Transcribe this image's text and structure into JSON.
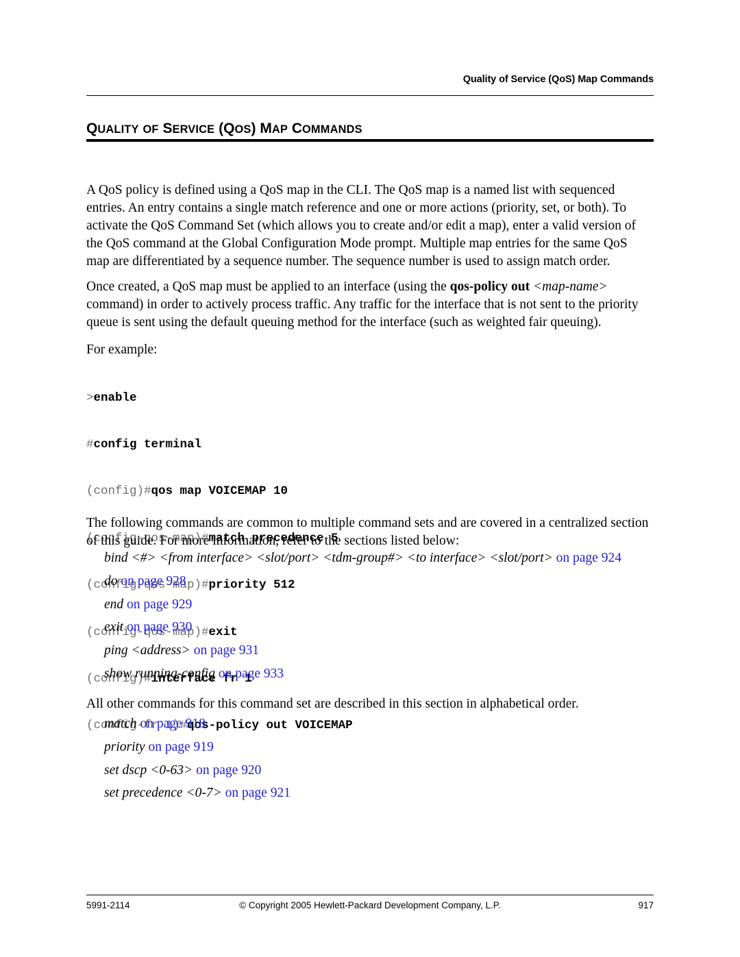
{
  "header": {
    "running_title": "Quality of Service (QoS) Map Commands"
  },
  "title": {
    "part1_cap": "Q",
    "part1_rest": "UALITY",
    "part2_cap": "",
    "part2_rest": "OF",
    "part3_cap": "S",
    "part3_rest": "ERVICE",
    "part4_cap": "(Q",
    "part4_rest": "OS",
    "part4_tail": ")",
    "part5_cap": "M",
    "part5_rest": "AP",
    "part6_cap": "C",
    "part6_rest": "OMMANDS"
  },
  "body": {
    "intro": "A QoS policy is defined using a QoS map in the CLI. The QoS map is a named list with sequenced entries. An entry contains a single match reference and one or more actions (priority, set, or both). To activate the QoS Command Set (which allows you to create and/or edit a map), enter a valid version of the QoS command at the Global Configuration Mode prompt. Multiple map entries for the same QoS map are differentiated by a sequence number. The sequence number is used to assign match order.",
    "apply_part1": "Once created, a QoS map must be applied to an interface (using the ",
    "apply_bold": "qos-policy out",
    "apply_italic": " <map-name>",
    "apply_part2": " command) in order to actively process traffic. Any traffic for the interface that is not sent to the priority queue is sent using the default queuing method for the interface (such as weighted fair queuing).",
    "for_example": "For example:",
    "common_intro": "The following commands are common to multiple command sets and are covered in a centralized section of this guide. For more information, refer to the sections listed below:",
    "all_other": "All other commands for this command set are described in this section in alphabetical order."
  },
  "code": {
    "lines": [
      {
        "prompt": ">",
        "cmd": "enable"
      },
      {
        "prompt": "#",
        "cmd": "config terminal"
      },
      {
        "prompt": "(config)#",
        "cmd": "qos map VOICEMAP 10"
      },
      {
        "prompt": "(config-qos-map)#",
        "cmd": "match precedence 5"
      },
      {
        "prompt": "(config-qos-map)#",
        "cmd": "priority 512"
      },
      {
        "prompt": "(config-qos-map)#",
        "cmd": "exit"
      },
      {
        "prompt": "(config)#",
        "cmd": "interface fr 1"
      },
      {
        "prompt": "(config-fr 1)#",
        "cmd": "qos-policy out VOICEMAP"
      }
    ]
  },
  "xrefs_common": [
    {
      "command": "bind <#> <from interface> <slot/port> <tdm-group#> <to interface> <slot/port>",
      "link": "on page 924",
      "link_style": "normal"
    },
    {
      "command": "do",
      "link": "on page 928",
      "link_style": "normal"
    },
    {
      "command": "end",
      "link": "on page 929",
      "link_style": "normal"
    },
    {
      "command": "exit",
      "link": "on page 930",
      "link_style": "normal"
    },
    {
      "command": "ping <address>",
      "link": "on page 931",
      "link_style": "normal"
    },
    {
      "command": "show running-config",
      "link": "on page 933",
      "link_style": "normal"
    }
  ],
  "xrefs_other": [
    {
      "command": "match",
      "link": "on page 918",
      "link_style": "normal"
    },
    {
      "command": "priority",
      "link": "on page 919",
      "link_style": "normal"
    },
    {
      "command": "set dscp <0-63>",
      "link": "on page 920",
      "link_style": "normal"
    },
    {
      "command": "set precedence <0-7>",
      "link": "on page 921",
      "link_style": "normal"
    }
  ],
  "footer": {
    "doc_number": "5991-2114",
    "copyright": "© Copyright 2005 Hewlett-Packard Development Company, L.P.",
    "page_number": "917"
  },
  "colors": {
    "link_blue": "#1f1fd6",
    "prompt_gray": "#6e6e6e",
    "text_black": "#000000"
  }
}
